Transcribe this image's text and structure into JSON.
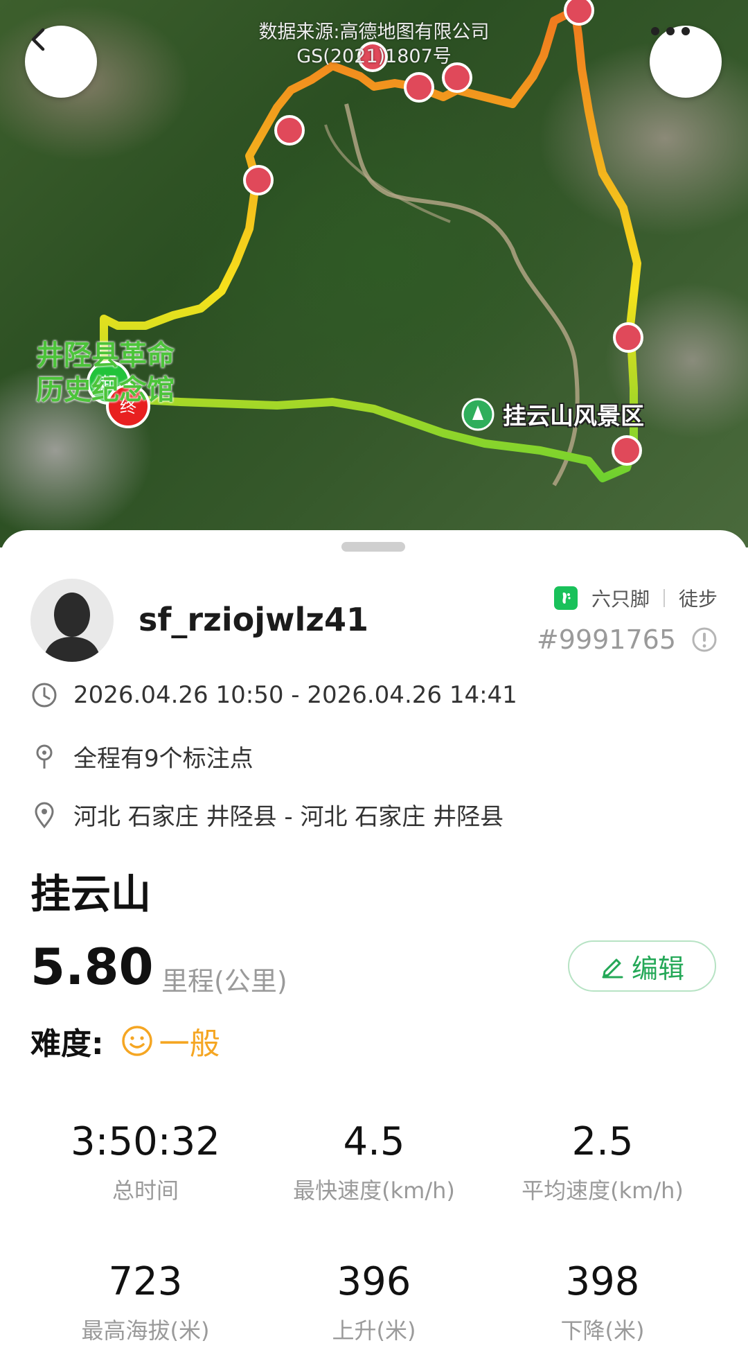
{
  "map": {
    "source_line1": "数据来源:高德地图有限公司",
    "source_line2": "GS(2021)1807号",
    "poi_label": "挂云山风景区",
    "museum_label_line1": "井陉县革命",
    "museum_label_line2": "历史纪念馆",
    "start_marker": "起",
    "end_marker": "终",
    "colors": {
      "route_start": "#6fd12f",
      "route_mid": "#f6e21c",
      "route_peak": "#f0771e",
      "photo_pin": "#e0495a"
    }
  },
  "header": {
    "back_icon": "chevron-left-icon",
    "more_icon": "more-dots-icon"
  },
  "profile": {
    "username": "sf_rziojwlz41",
    "app_name": "六只脚",
    "activity": "徒步",
    "track_id": "#9991765"
  },
  "details": {
    "time_range": "2026.04.26 10:50 - 2026.04.26 14:41",
    "markers": "全程有9个标注点",
    "location": "河北 石家庄 井陉县 - 河北 石家庄 井陉县"
  },
  "track": {
    "title": "挂云山",
    "distance": "5.80",
    "distance_unit": "里程(公里)",
    "edit_label": "编辑",
    "difficulty_label": "难度:",
    "difficulty_value": "一般"
  },
  "stats": [
    {
      "value": "3:50:32",
      "label": "总时间"
    },
    {
      "value": "4.5",
      "label": "最快速度(km/h)"
    },
    {
      "value": "2.5",
      "label": "平均速度(km/h)"
    },
    {
      "value": "723",
      "label": "最高海拔(米)"
    },
    {
      "value": "396",
      "label": "上升(米)"
    },
    {
      "value": "398",
      "label": "下降(米)"
    }
  ]
}
